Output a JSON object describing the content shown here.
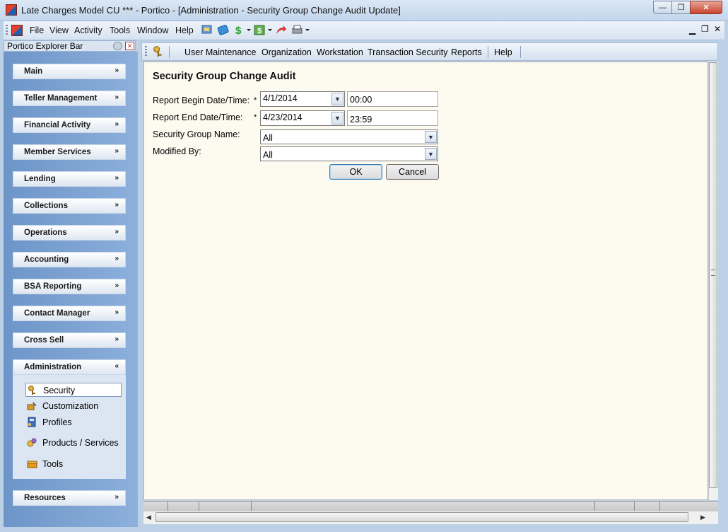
{
  "window": {
    "title": "Late Charges Model CU *** - Portico - [Administration - Security Group Change Audit Update]",
    "min_label": "🗕",
    "max_label": "🗗",
    "close_label": "✕"
  },
  "menubar": {
    "items": [
      "File",
      "View",
      "Activity",
      "Tools",
      "Window",
      "Help"
    ],
    "right_controls": [
      "–",
      "▫",
      "✕"
    ]
  },
  "explorer": {
    "title": "Portico Explorer Bar",
    "sections": [
      {
        "label": "Main",
        "chevron": "»"
      },
      {
        "label": "Teller Management",
        "chevron": "»"
      },
      {
        "label": "Financial Activity",
        "chevron": "»"
      },
      {
        "label": "Member Services",
        "chevron": "»"
      },
      {
        "label": "Lending",
        "chevron": "»"
      },
      {
        "label": "Collections",
        "chevron": "»"
      },
      {
        "label": "Operations",
        "chevron": "»"
      },
      {
        "label": "Accounting",
        "chevron": "»"
      },
      {
        "label": "BSA Reporting",
        "chevron": "»"
      },
      {
        "label": "Contact Manager",
        "chevron": "»"
      },
      {
        "label": "Cross Sell",
        "chevron": "»"
      },
      {
        "label": "Administration",
        "chevron": "«"
      },
      {
        "label": "Resources",
        "chevron": "»"
      }
    ],
    "admin_items": [
      {
        "label": "Security",
        "icon": "keys-icon",
        "selected": true
      },
      {
        "label": "Customization",
        "icon": "tools-icon"
      },
      {
        "label": "Profiles",
        "icon": "profiles-icon"
      },
      {
        "label": "Products / Services",
        "icon": "products-icon"
      },
      {
        "label": "Tools",
        "icon": "toolbox-icon"
      }
    ]
  },
  "content_toolbar": {
    "items": [
      "User Maintenance",
      "Organization",
      "Workstation",
      "Transaction Security",
      "Reports",
      "Help"
    ]
  },
  "form": {
    "title": "Security Group Change Audit",
    "begin_label": "Report Begin Date/Time:",
    "begin_date": "4/1/2014",
    "begin_time": "00:00",
    "end_label": "Report End Date/Time:",
    "end_date": "4/23/2014",
    "end_time": "23:59",
    "group_label": "Security Group Name:",
    "group_value": "All",
    "modified_label": "Modified By:",
    "modified_value": "All",
    "required_mark": "*",
    "ok_label": "OK",
    "cancel_label": "Cancel"
  },
  "colors": {
    "content_bg": "#fdfaf0",
    "explorer_bg": "#7aa0d2",
    "titlebar": "#c3d6ec"
  }
}
